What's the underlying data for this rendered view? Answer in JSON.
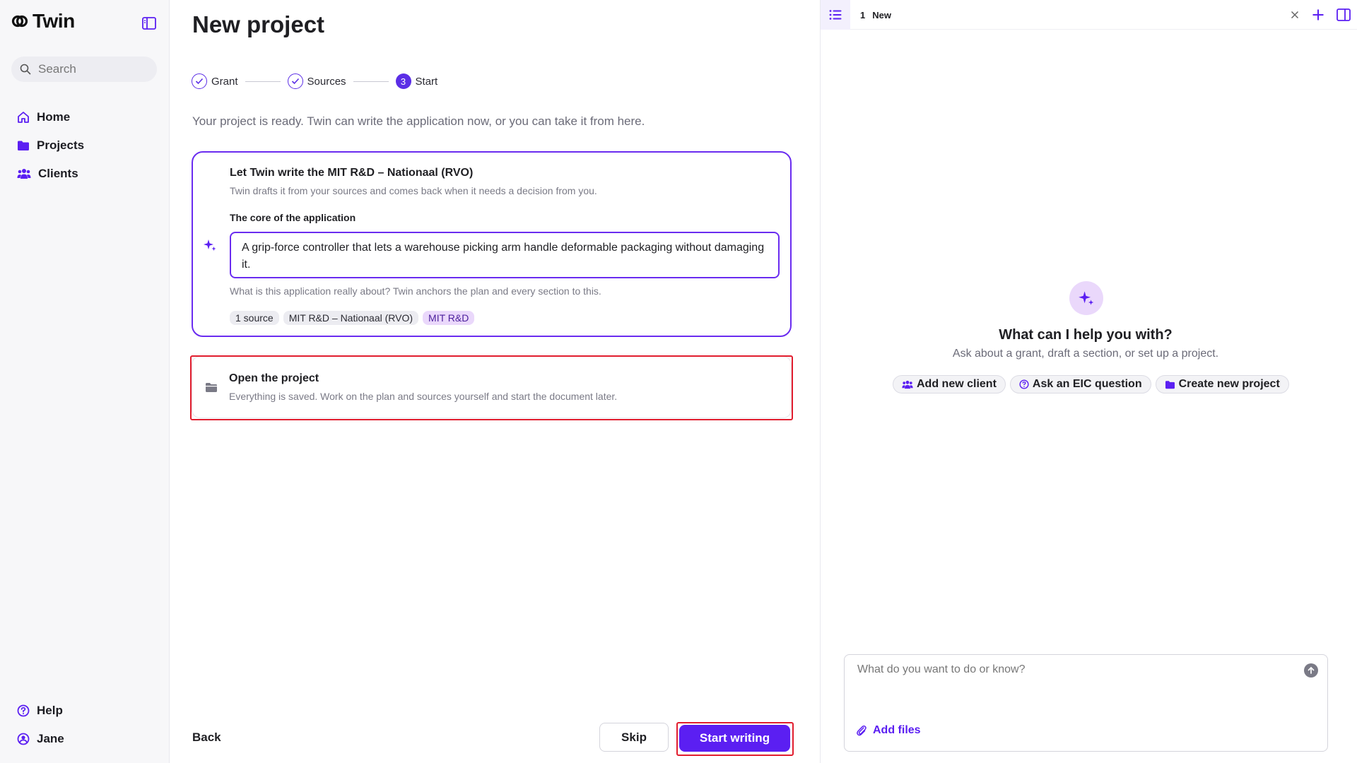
{
  "app": {
    "name": "Twin"
  },
  "sidebar": {
    "search_placeholder": "Search",
    "nav": [
      {
        "label": "Home",
        "icon": "home-icon"
      },
      {
        "label": "Projects",
        "icon": "folder-icon"
      },
      {
        "label": "Clients",
        "icon": "users-icon"
      }
    ],
    "bottom": [
      {
        "label": "Help",
        "icon": "help-icon"
      },
      {
        "label": "Jane",
        "icon": "user-icon"
      }
    ]
  },
  "main": {
    "title": "New project",
    "steps": [
      {
        "label": "Grant",
        "state": "done"
      },
      {
        "label": "Sources",
        "state": "done"
      },
      {
        "label": "Start",
        "state": "active",
        "number": "3"
      }
    ],
    "intro": "Your project is ready. Twin can write the application now, or you can take it from here.",
    "write_card": {
      "title": "Let Twin write the MIT R&D – Nationaal (RVO)",
      "subtitle": "Twin drafts it from your sources and comes back when it needs a decision from you.",
      "core_label": "The core of the application",
      "core_value": "A grip-force controller that lets a warehouse picking arm handle deformable packaging without damaging it.",
      "helper": "What is this application really about? Twin anchors the plan and every section to this.",
      "tags": [
        "1 source",
        "MIT R&D – Nationaal (RVO)",
        "MIT R&D"
      ]
    },
    "open_card": {
      "title": "Open the project",
      "subtitle": "Everything is saved. Work on the plan and sources yourself and start the document later."
    },
    "footer": {
      "back": "Back",
      "skip": "Skip",
      "start": "Start writing"
    }
  },
  "panel": {
    "tab_index": "1",
    "tab_label": "New",
    "help_title": "What can I help you with?",
    "help_sub": "Ask about a grant, draft a section, or set up a project.",
    "chips": [
      {
        "label": "Add new client",
        "icon": "users-icon"
      },
      {
        "label": "Ask an EIC question",
        "icon": "help-icon"
      },
      {
        "label": "Create new project",
        "icon": "folder-icon"
      }
    ],
    "composer_placeholder": "What do you want to do or know?",
    "add_files": "Add files"
  },
  "colors": {
    "accent": "#5b1ff2",
    "accent_light": "#ead8fb",
    "highlight": "#e11d2e"
  }
}
